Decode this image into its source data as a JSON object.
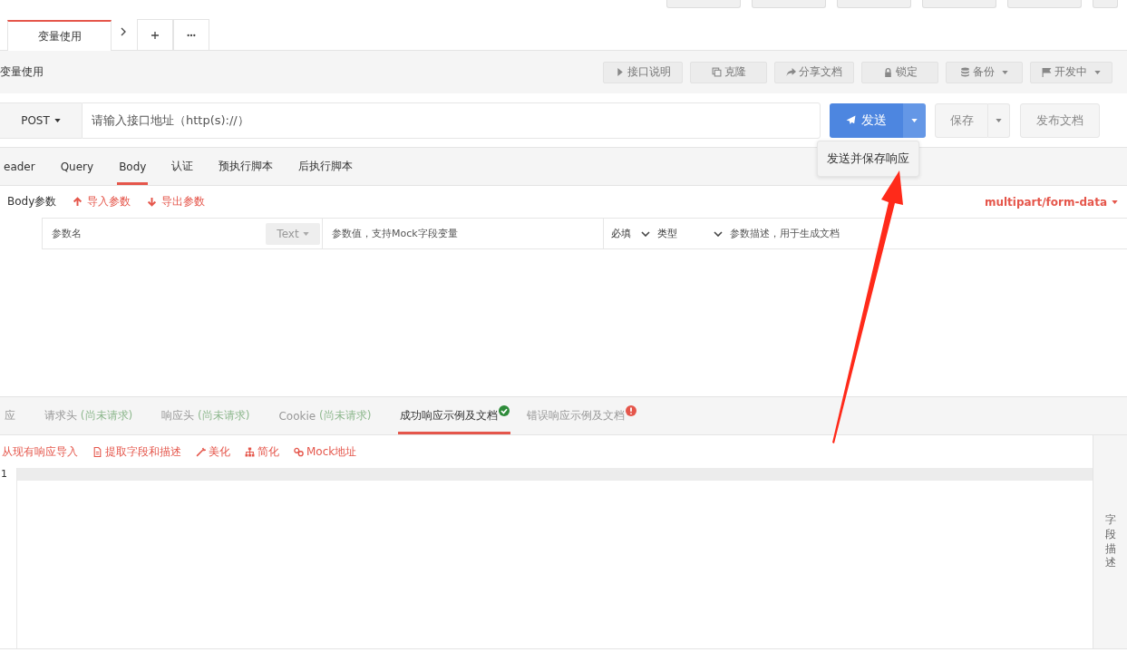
{
  "tabs": [
    {
      "label": "变量使用",
      "selected": true
    }
  ],
  "page_title": "变量使用",
  "toolbar": [
    {
      "label": "接口说明",
      "kind": "play",
      "dropdown": false
    },
    {
      "label": "克隆",
      "kind": "copy",
      "dropdown": false
    },
    {
      "label": "分享文档",
      "kind": "share",
      "dropdown": false
    },
    {
      "label": "锁定",
      "kind": "lock",
      "dropdown": false
    },
    {
      "label": "备份",
      "kind": "database",
      "dropdown": true
    },
    {
      "label": "开发中",
      "kind": "flag",
      "dropdown": true
    }
  ],
  "request": {
    "method": "POST",
    "url_placeholder": "请输入接口地址（http(s)://）",
    "send": "发送",
    "save": "保存",
    "publish": "发布文档"
  },
  "send_menu": {
    "open": true,
    "items": [
      "发送并保存响应"
    ]
  },
  "request_tabs": [
    {
      "label": "eader",
      "selected": false
    },
    {
      "label": "Query",
      "selected": false
    },
    {
      "label": "Body",
      "selected": true
    },
    {
      "label": "认证",
      "selected": false
    },
    {
      "label": "预执行脚本",
      "selected": false
    },
    {
      "label": "后执行脚本",
      "selected": false
    }
  ],
  "body": {
    "label": "Body参数",
    "actions": [
      {
        "label": "导入参数",
        "kind": "import"
      },
      {
        "label": "导出参数",
        "kind": "export"
      }
    ],
    "content_type": "multipart/form-data"
  },
  "param_row": {
    "name_placeholder": "参数名",
    "type_badge": "Text",
    "value_placeholder": "参数值，支持Mock字段变量",
    "required": "必填",
    "type": "类型",
    "desc_placeholder": "参数描述，用于生成文档"
  },
  "response_tabs": [
    {
      "label": "应",
      "selected": false,
      "kind": "plain"
    },
    {
      "label": "请求头",
      "note": "(尚未请求)",
      "selected": false,
      "kind": "plain"
    },
    {
      "label": "响应头",
      "note": "(尚未请求)",
      "selected": false,
      "kind": "plain"
    },
    {
      "label": "Cookie",
      "note": "(尚未请求)",
      "selected": false,
      "kind": "plain"
    },
    {
      "label": "成功响应示例及文档",
      "selected": true,
      "kind": "success"
    },
    {
      "label": "错误响应示例及文档",
      "selected": false,
      "kind": "error"
    }
  ],
  "response_actions": [
    {
      "label": "从现有响应导入",
      "kind": "plain"
    },
    {
      "label": "提取字段和描述",
      "kind": "file"
    },
    {
      "label": "美化",
      "kind": "wand"
    },
    {
      "label": "简化",
      "kind": "tree"
    },
    {
      "label": "Mock地址",
      "kind": "link"
    }
  ],
  "editor": {
    "lines": [
      "1"
    ]
  },
  "side_panel": {
    "label": "字段描述"
  }
}
